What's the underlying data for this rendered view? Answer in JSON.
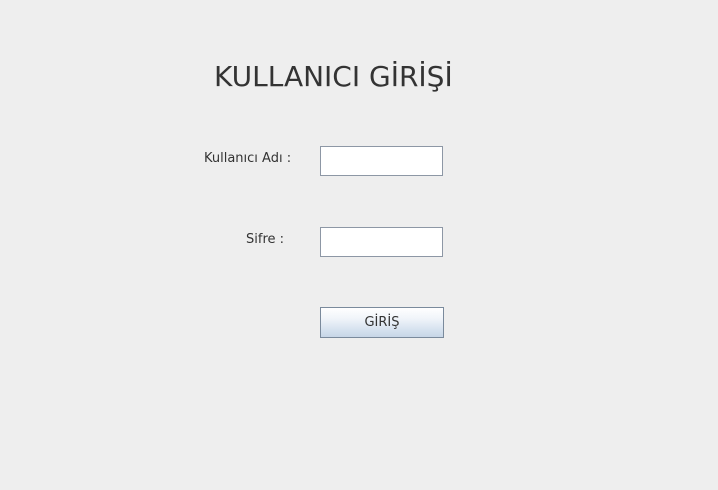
{
  "login": {
    "title": "KULLANICI GİRİŞİ",
    "username_label": "Kullanıcı Adı :",
    "username_value": "",
    "password_label": "Sifre :",
    "password_value": "",
    "submit_label": "GİRİŞ"
  }
}
